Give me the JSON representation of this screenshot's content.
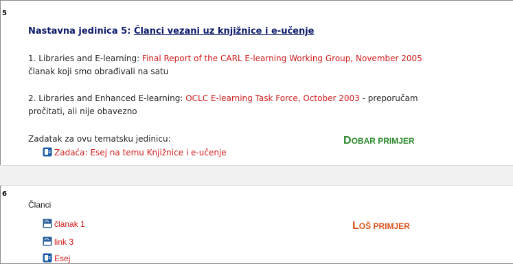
{
  "section5": {
    "number": "5",
    "title_prefix": "Nastavna jedinica 5: ",
    "title_link": "Članci vezani uz knjižnice i e-učenje",
    "item1": {
      "prefix": "1. Libraries and E-learning: ",
      "link": "Final Report of the CARL E-learning Working Group, November 2005",
      "desc": "članak koji smo obrađivali na satu"
    },
    "item2": {
      "prefix": "2. Libraries and Enhanced E-learning: ",
      "link": "OCLC E-learning Task Force, October 2003",
      "suffix": " - preporučam",
      "desc": "pročitati, ali nije obavezno"
    },
    "task_label": "Zadatak za ovu tematsku jedinicu:",
    "task_link": "Zadaća: Esej na temu Knjižnice i e-učenje",
    "note": {
      "first": "D",
      "rest": "OBAR PRIMJER",
      "color": "#2a8a2a"
    }
  },
  "section6": {
    "number": "6",
    "heading": "Članci",
    "items": [
      {
        "label": "članak 1",
        "icon": "pdf-icon"
      },
      {
        "label": "link 3",
        "icon": "pdf-icon"
      },
      {
        "label": "Esej",
        "icon": "assignment-icon"
      }
    ],
    "note": {
      "first": "L",
      "rest": "OŠ PRIMJER",
      "color": "#d9531e"
    }
  }
}
